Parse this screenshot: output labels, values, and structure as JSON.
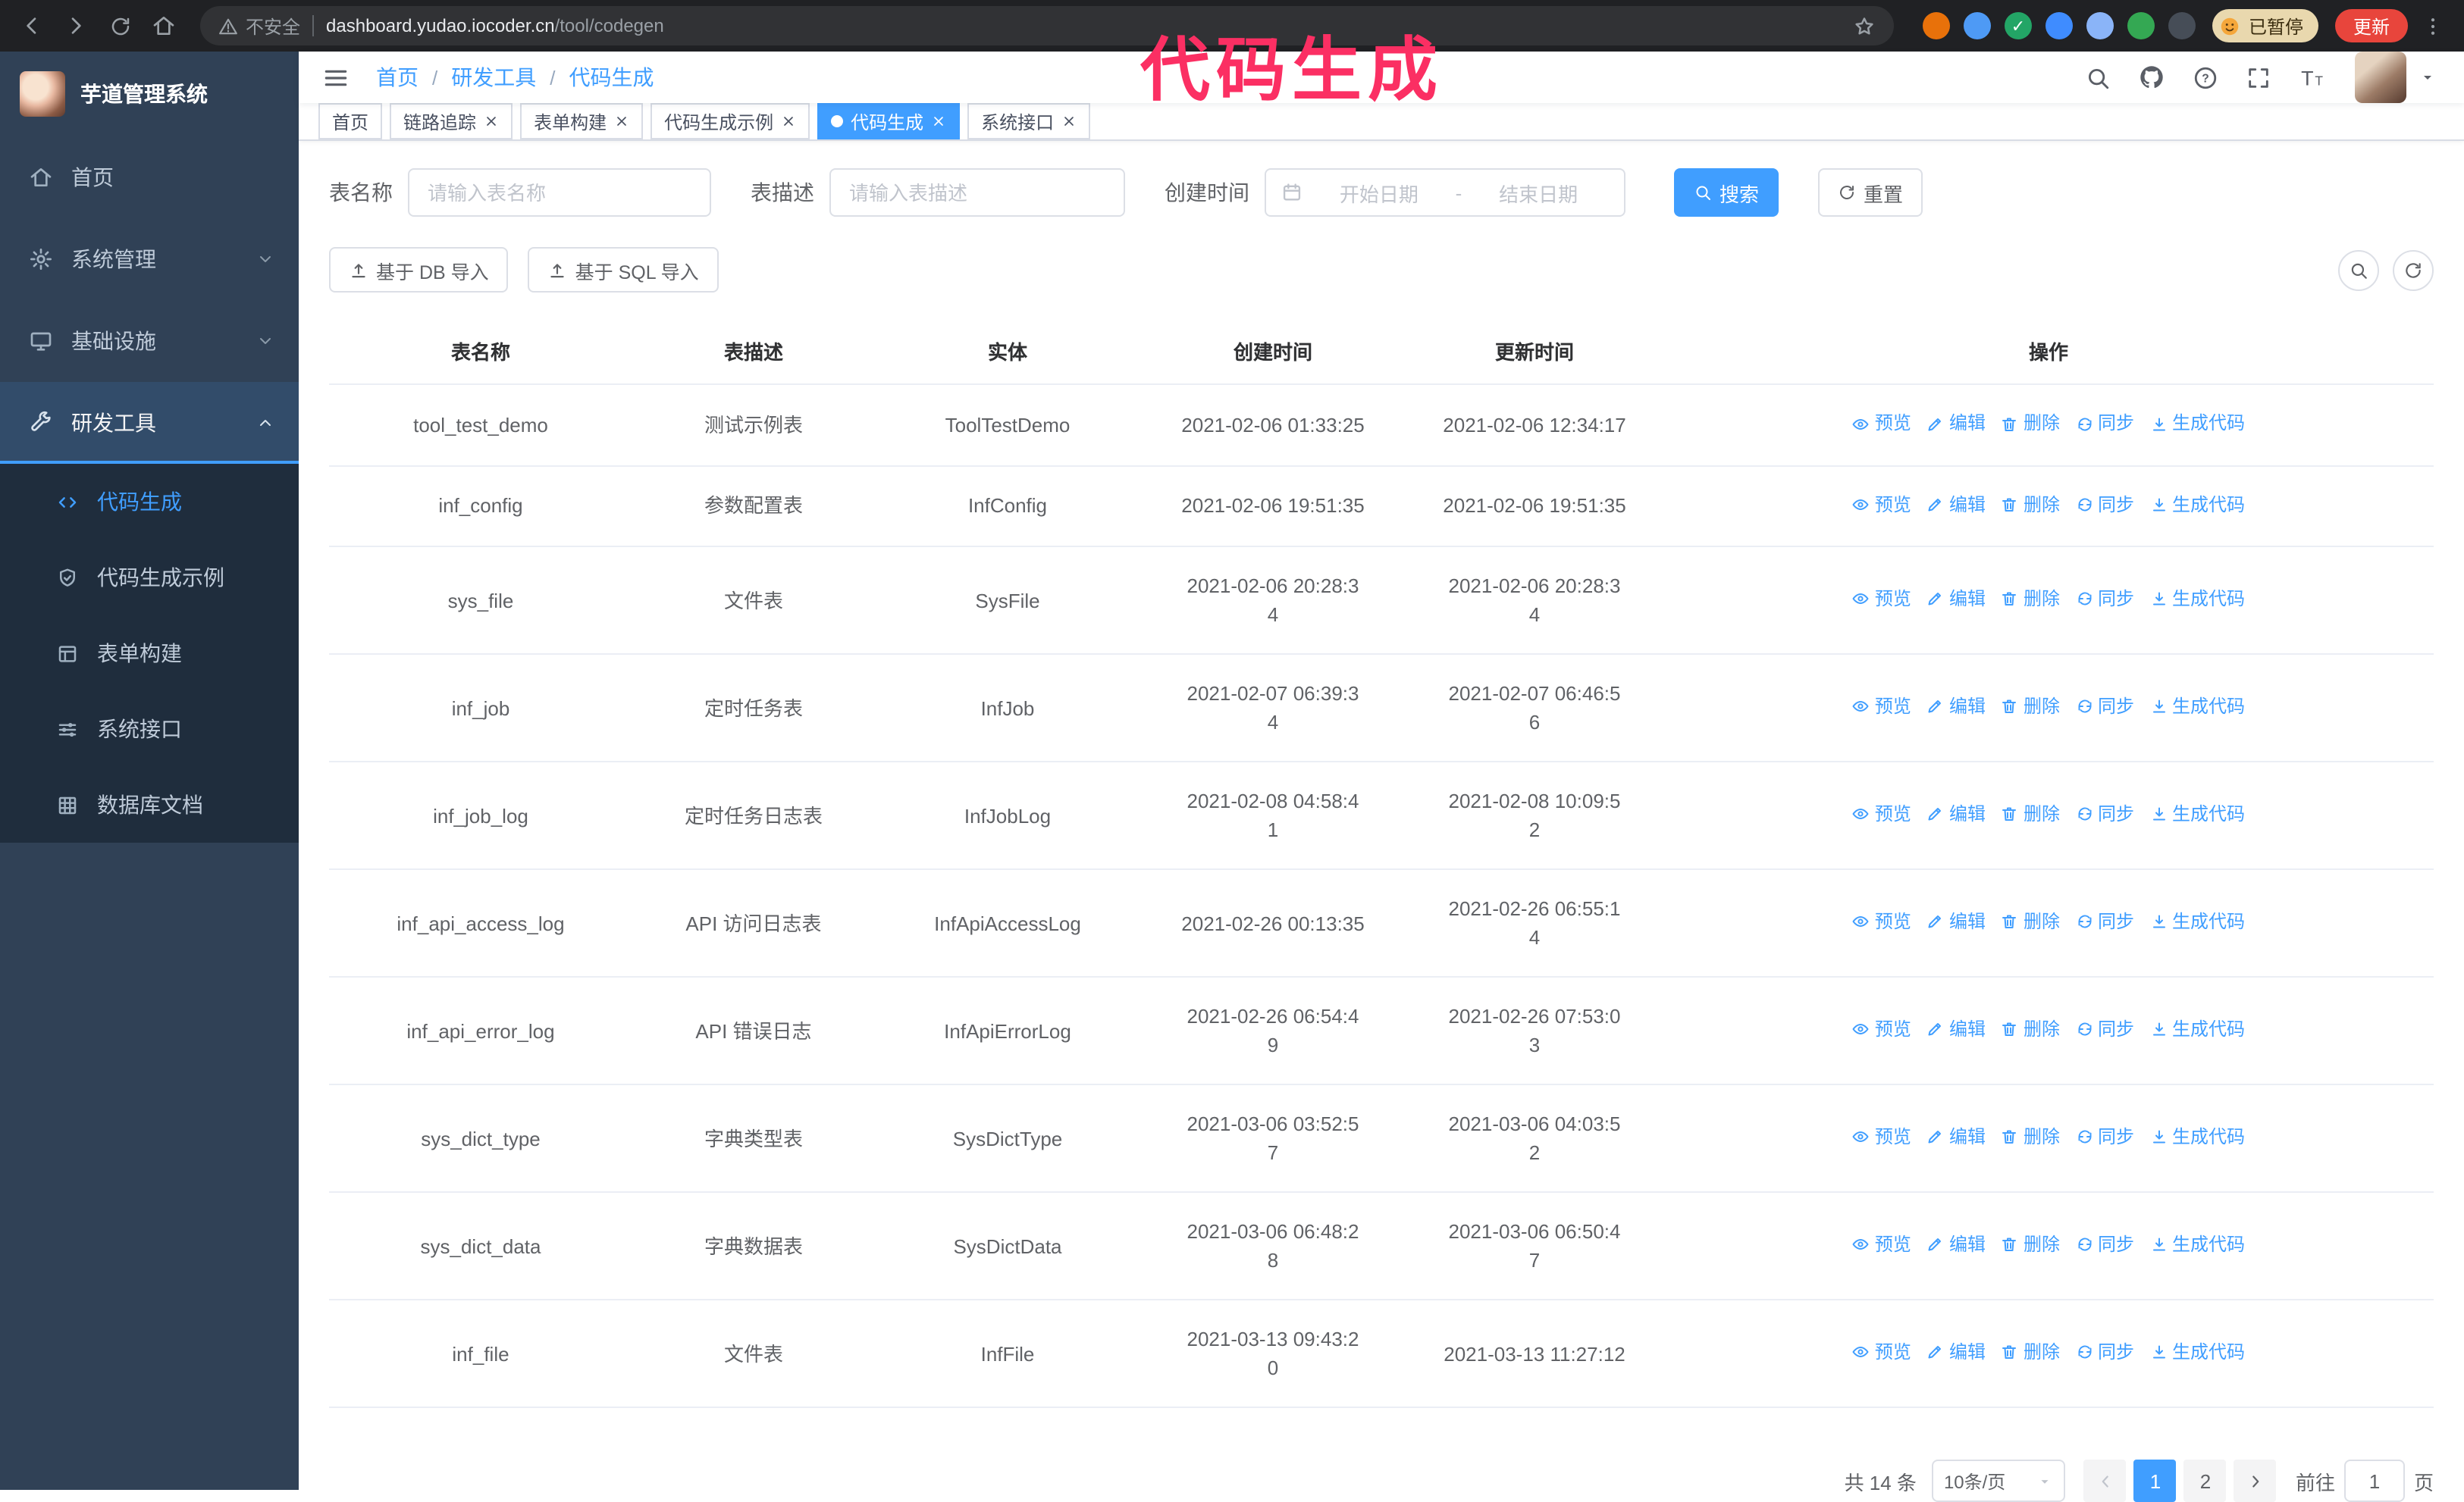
{
  "colors": {
    "primary": "#409EFF",
    "sidebar_bg": "#304156",
    "submenu_bg": "#1f2d3d",
    "browser_bar_bg": "#202124",
    "annotation": "#fb2f63",
    "update_button_bg": "#e8453c"
  },
  "annotation": {
    "text": "代码生成",
    "color": "#fb2f63"
  },
  "browser": {
    "security_label": "不安全",
    "url_host": "dashboard.yudao.iocoder.cn",
    "url_path": "/tool/codegen",
    "paused_badge": "已暂停",
    "update_button": "更新",
    "extensions": [
      {
        "name": "extension-icon-1",
        "color": "#e8710a"
      },
      {
        "name": "extension-icon-2",
        "color": "#4e9af5"
      },
      {
        "name": "extension-icon-3",
        "color": "#23a566",
        "glyph": "✓"
      },
      {
        "name": "extension-icon-4",
        "color": "#3f8cff"
      },
      {
        "name": "extension-icon-5",
        "color": "#8ab4f8"
      },
      {
        "name": "extension-icon-6",
        "color": "#34a853"
      },
      {
        "name": "extension-icon-7",
        "color": "#464d57"
      }
    ]
  },
  "sidebar": {
    "logo_title": "芋道管理系统",
    "items": [
      {
        "key": "home",
        "label": "首页",
        "icon": "home-icon",
        "type": "item"
      },
      {
        "key": "system",
        "label": "系统管理",
        "icon": "gear-icon",
        "type": "group",
        "expanded": false
      },
      {
        "key": "infra",
        "label": "基础设施",
        "icon": "infra-icon",
        "type": "group",
        "expanded": false
      },
      {
        "key": "devtools",
        "label": "研发工具",
        "icon": "tools-icon",
        "type": "group",
        "expanded": true,
        "children": [
          {
            "key": "codegen",
            "label": "代码生成",
            "icon": "code-icon",
            "active": true
          },
          {
            "key": "codegen-example",
            "label": "代码生成示例",
            "icon": "example-icon",
            "active": false
          },
          {
            "key": "form-builder",
            "label": "表单构建",
            "icon": "form-icon",
            "active": false
          },
          {
            "key": "api",
            "label": "系统接口",
            "icon": "api-icon",
            "active": false
          },
          {
            "key": "db-doc",
            "label": "数据库文档",
            "icon": "db-doc-icon",
            "active": false
          }
        ]
      }
    ]
  },
  "header": {
    "breadcrumb": [
      "首页",
      "研发工具",
      "代码生成"
    ]
  },
  "tags": [
    {
      "label": "首页",
      "closable": false,
      "active": false
    },
    {
      "label": "链路追踪",
      "closable": true,
      "active": false
    },
    {
      "label": "表单构建",
      "closable": true,
      "active": false
    },
    {
      "label": "代码生成示例",
      "closable": true,
      "active": false
    },
    {
      "label": "代码生成",
      "closable": true,
      "active": true
    },
    {
      "label": "系统接口",
      "closable": true,
      "active": false
    }
  ],
  "filters": {
    "table_name_label": "表名称",
    "table_name_placeholder": "请输入表名称",
    "table_desc_label": "表描述",
    "table_desc_placeholder": "请输入表描述",
    "create_time_label": "创建时间",
    "date_start_placeholder": "开始日期",
    "date_separator": "-",
    "date_end_placeholder": "结束日期",
    "search_button": "搜索",
    "reset_button": "重置"
  },
  "toolbar": {
    "import_db_button": "基于 DB 导入",
    "import_sql_button": "基于 SQL 导入"
  },
  "table": {
    "columns": [
      "表名称",
      "表描述",
      "实体",
      "创建时间",
      "更新时间",
      "操作"
    ],
    "actions": [
      {
        "key": "preview",
        "label": "预览",
        "icon": "eye-icon"
      },
      {
        "key": "edit",
        "label": "编辑",
        "icon": "edit-icon"
      },
      {
        "key": "delete",
        "label": "删除",
        "icon": "delete-icon"
      },
      {
        "key": "sync",
        "label": "同步",
        "icon": "sync-icon"
      },
      {
        "key": "generate",
        "label": "生成代码",
        "icon": "download-icon"
      }
    ],
    "rows": [
      {
        "name": "tool_test_demo",
        "desc": "测试示例表",
        "entity": "ToolTestDemo",
        "create_time": "2021-02-06 01:33:25",
        "update_time": "2021-02-06 12:34:17",
        "create_time_wrapped": false,
        "update_time_wrapped": false
      },
      {
        "name": "inf_config",
        "desc": "参数配置表",
        "entity": "InfConfig",
        "create_time": "2021-02-06 19:51:35",
        "update_time": "2021-02-06 19:51:35",
        "create_time_wrapped": false,
        "update_time_wrapped": false
      },
      {
        "name": "sys_file",
        "desc": "文件表",
        "entity": "SysFile",
        "create_time": "2021-02-06 20:28:34",
        "update_time": "2021-02-06 20:28:34",
        "create_time_wrapped": true,
        "update_time_wrapped": true
      },
      {
        "name": "inf_job",
        "desc": "定时任务表",
        "entity": "InfJob",
        "create_time": "2021-02-07 06:39:34",
        "update_time": "2021-02-07 06:46:56",
        "create_time_wrapped": true,
        "update_time_wrapped": true
      },
      {
        "name": "inf_job_log",
        "desc": "定时任务日志表",
        "entity": "InfJobLog",
        "create_time": "2021-02-08 04:58:41",
        "update_time": "2021-02-08 10:09:52",
        "create_time_wrapped": true,
        "update_time_wrapped": true
      },
      {
        "name": "inf_api_access_log",
        "desc": "API 访问日志表",
        "entity": "InfApiAccessLog",
        "create_time": "2021-02-26 00:13:35",
        "update_time": "2021-02-26 06:55:14",
        "create_time_wrapped": false,
        "update_time_wrapped": true
      },
      {
        "name": "inf_api_error_log",
        "desc": "API 错误日志",
        "entity": "InfApiErrorLog",
        "create_time": "2021-02-26 06:54:49",
        "update_time": "2021-02-26 07:53:03",
        "create_time_wrapped": true,
        "update_time_wrapped": true
      },
      {
        "name": "sys_dict_type",
        "desc": "字典类型表",
        "entity": "SysDictType",
        "create_time": "2021-03-06 03:52:57",
        "update_time": "2021-03-06 04:03:52",
        "create_time_wrapped": true,
        "update_time_wrapped": true
      },
      {
        "name": "sys_dict_data",
        "desc": "字典数据表",
        "entity": "SysDictData",
        "create_time": "2021-03-06 06:48:28",
        "update_time": "2021-03-06 06:50:47",
        "create_time_wrapped": true,
        "update_time_wrapped": true
      },
      {
        "name": "inf_file",
        "desc": "文件表",
        "entity": "InfFile",
        "create_time": "2021-03-13 09:43:20",
        "update_time": "2021-03-13 11:27:12",
        "create_time_wrapped": true,
        "update_time_wrapped": false
      }
    ]
  },
  "pagination": {
    "total_text": "共 14 条",
    "page_size": "10条/页",
    "pages": [
      "1",
      "2"
    ],
    "current_page": "1",
    "goto_label": "前往",
    "goto_value": "1",
    "goto_suffix": "页"
  }
}
